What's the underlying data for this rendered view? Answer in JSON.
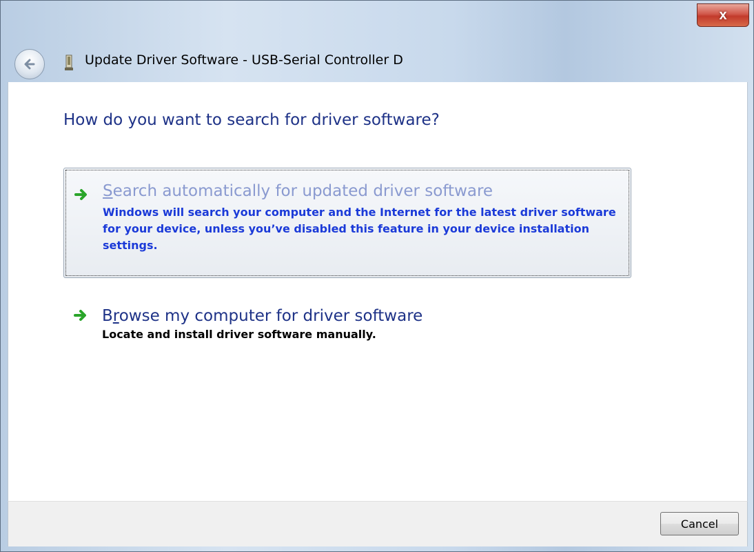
{
  "window": {
    "title": "Update Driver Software - USB-Serial Controller D",
    "close_label": "x"
  },
  "heading": "How do you want to search for driver software?",
  "options": [
    {
      "title_accesskey": "S",
      "title_rest": "earch automatically for updated driver software",
      "description": "Windows will search your computer and the Internet for the latest driver software for your device, unless you’ve disabled this feature in your device installation settings.",
      "selected": true
    },
    {
      "title_prefix": "B",
      "title_accesskey": "r",
      "title_rest": "owse my computer for driver software",
      "description": "Locate and install driver software manually.",
      "selected": false
    }
  ],
  "footer": {
    "cancel_label": "Cancel"
  },
  "colors": {
    "heading": "#1e3287",
    "link": "#1b3ad8",
    "arrow": "#2aa52a",
    "close": "#c23a2b"
  },
  "icons": [
    "back-arrow-icon",
    "usb-device-icon",
    "green-arrow-icon",
    "close-icon"
  ]
}
